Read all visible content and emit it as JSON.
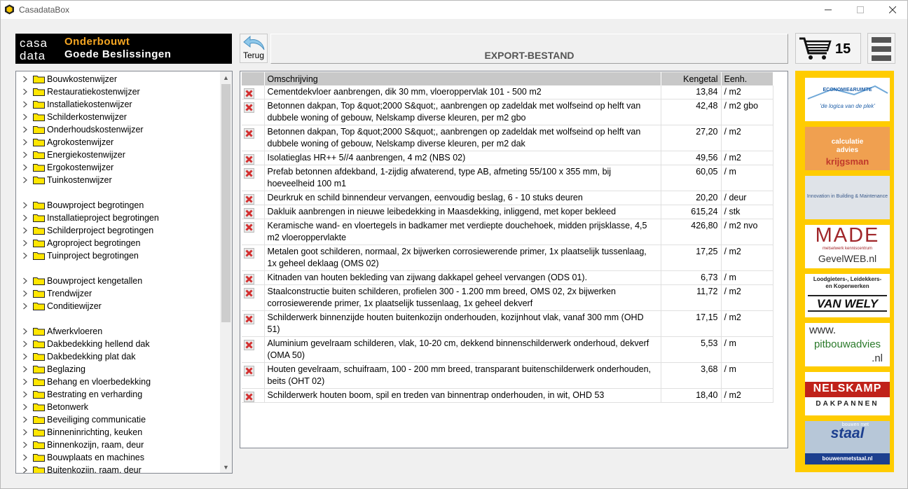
{
  "window": {
    "title": "CasadataBox"
  },
  "logo": {
    "brand": "casa data",
    "line1": "Onderbouwt",
    "line2": "Goede Beslissingen"
  },
  "toolbar": {
    "back_label": "Terug"
  },
  "header": {
    "title": "EXPORT-BESTAND"
  },
  "cart": {
    "count": "15"
  },
  "tree": {
    "group1": [
      "Bouwkostenwijzer",
      "Restauratiekostenwijzer",
      "Installatiekostenwijzer",
      "Schilderkostenwijzer",
      "Onderhoudskostenwijzer",
      "Agrokostenwijzer",
      "Energiekostenwijzer",
      "Ergokostenwijzer",
      "Tuinkostenwijzer"
    ],
    "group2": [
      "Bouwproject begrotingen",
      "Installatieproject begrotingen",
      "Schilderproject begrotingen",
      "Agroproject begrotingen",
      "Tuinproject begrotingen"
    ],
    "group3": [
      "Bouwproject kengetallen",
      "Trendwijzer",
      "Conditiewijzer"
    ],
    "group4": [
      "Afwerkvloeren",
      "Dakbedekking hellend dak",
      "Dakbedekking plat dak",
      "Beglazing",
      "Behang en vloerbedekking",
      "Bestrating en verharding",
      "Betonwerk",
      "Beveiliging communicatie",
      "Binneninrichting, keuken",
      "Binnenkozijn, raam, deur",
      "Bouwplaats en machines",
      "Buitenkozijn, raam, deur"
    ]
  },
  "table": {
    "headers": {
      "description": "Omschrijving",
      "value": "Kengetal",
      "unit": "Eenh."
    },
    "rows": [
      {
        "description": "Cementdekvloer aanbrengen, dik 30 mm, vloeroppervlak 101 - 500 m2",
        "value": "13,84",
        "unit": "/ m2"
      },
      {
        "description": "Betonnen dakpan, Top &quot;2000 S&quot;, aanbrengen op zadeldak met wolfseind op helft van dubbele woning of gebouw, Nelskamp diverse kleuren, per m2 gbo",
        "value": "42,48",
        "unit": "/ m2 gbo"
      },
      {
        "description": "Betonnen dakpan, Top &quot;2000 S&quot;, aanbrengen op zadeldak met wolfseind op helft van dubbele woning of gebouw, Nelskamp diverse kleuren, per m2 dak",
        "value": "27,20",
        "unit": "/ m2"
      },
      {
        "description": "Isolatieglas HR++ 5//4 aanbrengen, 4 m2 (NBS 02)",
        "value": "49,56",
        "unit": "/ m2"
      },
      {
        "description": "Prefab betonnen afdekband, 1-zijdig afwaterend, type AB, afmeting 55/100 x 355 mm, bij hoeveelheid 100 m1",
        "value": "60,05",
        "unit": "/ m"
      },
      {
        "description": "Deurkruk en schild binnendeur vervangen, eenvoudig beslag, 6 - 10 stuks deuren",
        "value": "20,20",
        "unit": "/ deur"
      },
      {
        "description": "Dakluik aanbrengen in nieuwe leibedekking in Maasdekking, inliggend, met koper bekleed",
        "value": "615,24",
        "unit": "/ stk"
      },
      {
        "description": "Keramische wand- en vloertegels in badkamer met verdiepte douchehoek, midden prijsklasse, 4,5 m2 vloeroppervlakte",
        "value": "426,80",
        "unit": "/ m2 nvo"
      },
      {
        "description": "Metalen goot schilderen, normaal, 2x bijwerken corrosiewerende primer, 1x plaatselijk tussenlaag, 1x geheel deklaag (OMS 02)",
        "value": "17,25",
        "unit": "/ m2"
      },
      {
        "description": "Kitnaden van houten bekleding van zijwang dakkapel geheel vervangen (ODS 01).",
        "value": "6,73",
        "unit": "/ m"
      },
      {
        "description": "Staalconstructie buiten schilderen, profielen 300 - 1.200 mm breed, OMS 02, 2x bijwerken corrosiewerende primer, 1x plaatselijk tussenlaag, 1x geheel dekverf",
        "value": "11,72",
        "unit": "/ m2"
      },
      {
        "description": "Schilderwerk binnenzijde houten buitenkozijn onderhouden, kozijnhout vlak, vanaf 300 mm (OHD 51)",
        "value": "17,15",
        "unit": "/ m2"
      },
      {
        "description": "Aluminium gevelraam schilderen, vlak, 10-20 cm, dekkend binnenschilderwerk onderhoud, dekverf (OMA 50)",
        "value": "5,53",
        "unit": "/ m"
      },
      {
        "description": "Houten gevelraam, schuifraam, 100 - 200 mm breed, transparant buitenschilderwerk onderhouden, beits (OHT 02)",
        "value": "3,68",
        "unit": "/ m"
      },
      {
        "description": "Schilderwerk houten boom, spil en treden van binnentrap onderhouden, in wit, OHD 53",
        "value": "18,40",
        "unit": "/ m2"
      }
    ]
  },
  "ads": {
    "economie": {
      "line1": "ECONOMIE&RUIMTE",
      "line2": "'de logica van de plek'"
    },
    "krijgsman": {
      "line1": "calculatie",
      "line2": "advies",
      "line3": "krijgsman"
    },
    "innovation": {
      "text": "Innovation in Building & Maintenance"
    },
    "made": {
      "line1": "MADE",
      "line2": "metselwerk kenniscentrum",
      "line3": "GevelWEB.nl"
    },
    "vanwely": {
      "line1": "Loodgieters-, Leidekkers-",
      "line2": "en Koperwerken",
      "line3": "VAN WELY"
    },
    "pitbouw": {
      "line1": "www.",
      "line2": "pitbouwadvies",
      "line3": ".nl"
    },
    "nelskamp": {
      "line1": "NELSKAMP",
      "line2": "DAKPANNEN"
    },
    "staal": {
      "line1": "bouwen met",
      "line2": "staal",
      "line3": "bouwenmetstaal.nl"
    }
  },
  "colors": {
    "logo_orange": "#f5a623",
    "ad_background": "#ffcc00",
    "delete_red": "#d32f2f",
    "folder_yellow": "#ffe600"
  }
}
